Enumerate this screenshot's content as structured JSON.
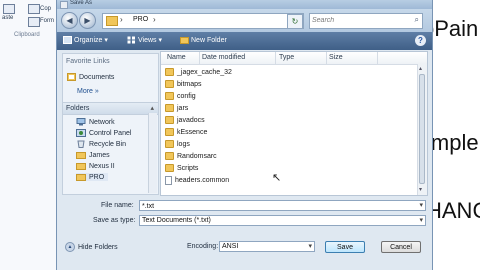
{
  "background_app": {
    "left_tools": [
      "aste",
      "Cop",
      "Form",
      "Clipboard"
    ],
    "right_text": [
      "oPain",
      "imple",
      "HANC"
    ]
  },
  "dialog": {
    "title": "Save As",
    "address": {
      "crumb": "PRO"
    },
    "search": {
      "placeholder": "Search"
    },
    "toolbar": {
      "organize": "Organize",
      "views": "Views",
      "new_folder": "New Folder",
      "help": "?"
    },
    "favorite_links": {
      "header": "Favorite Links",
      "items": [
        {
          "label": "Documents",
          "icon": "documents-icon"
        }
      ],
      "more": "More »"
    },
    "folders": {
      "header": "Folders",
      "items": [
        {
          "label": "Network",
          "icon": "network-icon"
        },
        {
          "label": "Control Panel",
          "icon": "control-panel-icon"
        },
        {
          "label": "Recycle Bin",
          "icon": "recycle-bin-icon"
        },
        {
          "label": "James",
          "icon": "folder-icon"
        },
        {
          "label": "Nexus II",
          "icon": "folder-icon"
        },
        {
          "label": "PRO",
          "icon": "folder-icon",
          "selected": true
        }
      ]
    },
    "columns": [
      "Name",
      "Date modified",
      "Type",
      "Size"
    ],
    "files": [
      {
        "name": "_jagex_cache_32",
        "kind": "folder"
      },
      {
        "name": "bitmaps",
        "kind": "folder"
      },
      {
        "name": "config",
        "kind": "folder"
      },
      {
        "name": "jars",
        "kind": "folder"
      },
      {
        "name": "javadocs",
        "kind": "folder"
      },
      {
        "name": "kEssence",
        "kind": "folder"
      },
      {
        "name": "logs",
        "kind": "folder"
      },
      {
        "name": "Randomsarc",
        "kind": "folder"
      },
      {
        "name": "Scripts",
        "kind": "folder"
      },
      {
        "name": "headers.common",
        "kind": "file"
      }
    ],
    "file_name": {
      "label": "File name:",
      "value": "*.txt"
    },
    "save_as_type": {
      "label": "Save as type:",
      "value": "Text Documents (*.txt)"
    },
    "hide_folders": "Hide Folders",
    "encoding": {
      "label": "Encoding:",
      "value": "ANSI"
    },
    "buttons": {
      "save": "Save",
      "cancel": "Cancel"
    }
  }
}
